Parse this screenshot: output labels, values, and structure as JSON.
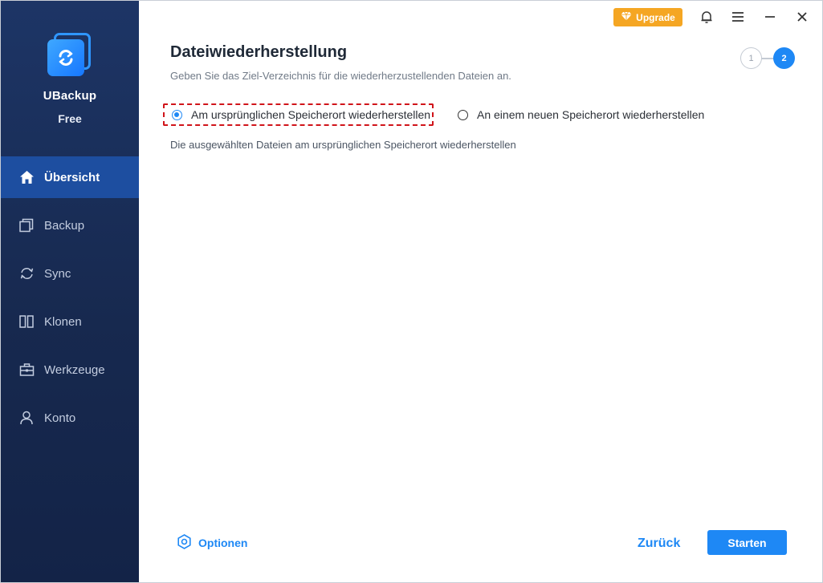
{
  "app": {
    "name": "UBackup",
    "edition": "Free"
  },
  "topbar": {
    "upgrade_label": "Upgrade"
  },
  "sidebar": {
    "items": [
      {
        "label": "Übersicht",
        "icon": "home-icon",
        "active": true
      },
      {
        "label": "Backup",
        "icon": "backup-icon",
        "active": false
      },
      {
        "label": "Sync",
        "icon": "sync-icon",
        "active": false
      },
      {
        "label": "Klonen",
        "icon": "clone-icon",
        "active": false
      },
      {
        "label": "Werkzeuge",
        "icon": "toolbox-icon",
        "active": false
      },
      {
        "label": "Konto",
        "icon": "user-icon",
        "active": false
      }
    ]
  },
  "main": {
    "title": "Dateiwiederherstellung",
    "subtitle": "Geben Sie das Ziel-Verzeichnis für die wiederherzustellenden Dateien an.",
    "steps": [
      "1",
      "2"
    ],
    "current_step": 2,
    "options": [
      {
        "label": "Am ursprünglichen Speicherort wiederherstellen",
        "selected": true
      },
      {
        "label": "An einem neuen Speicherort wiederherstellen",
        "selected": false
      }
    ],
    "description": "Die ausgewählten Dateien am ursprünglichen Speicherort wiederherstellen"
  },
  "footer": {
    "options_label": "Optionen",
    "back_label": "Zurück",
    "start_label": "Starten"
  },
  "colors": {
    "accent": "#1e88f5",
    "sidebar_bg": "#17294f",
    "sidebar_active": "#1d4ea0",
    "upgrade": "#f5a623",
    "highlight": "#d0141a"
  }
}
